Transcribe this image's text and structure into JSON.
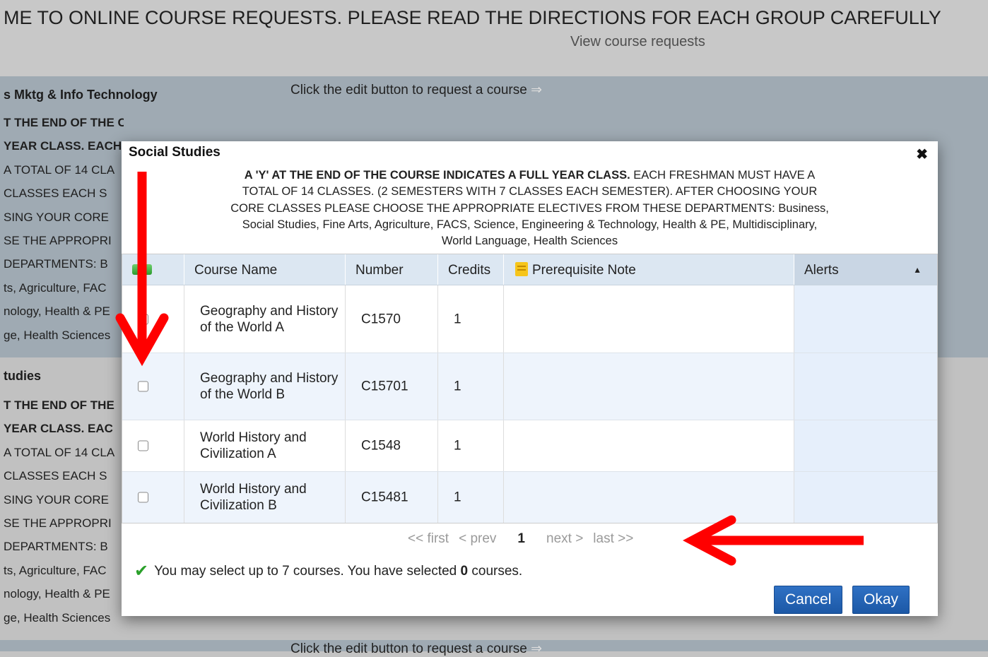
{
  "banner": {
    "title": "ME TO ONLINE COURSE REQUESTS. PLEASE READ THE DIRECTIONS FOR EACH GROUP CAREFULLY",
    "view_link": "View course requests"
  },
  "background": {
    "group1_heading": "s Mktg & Info Technology",
    "group2_heading": "tudies",
    "hint": "Click the edit button to request a course",
    "hint_bottom": "Click the edit button to request a course",
    "group1_lines": [
      "T THE END OF THE COURSE INDICATES A",
      "YEAR CLASS. EACH",
      "A TOTAL OF 14 CLA",
      "CLASSES EACH S",
      "SING YOUR CORE",
      "SE THE APPROPRI",
      "DEPARTMENTS: B",
      "ts, Agriculture, FAC",
      "nology, Health & PE",
      "ge, Health Sciences"
    ],
    "group2_lines": [
      "T THE END OF THE",
      "YEAR CLASS. EAC",
      "A TOTAL OF 14 CLA",
      "CLASSES EACH S",
      "SING YOUR CORE",
      "SE THE APPROPRI",
      "DEPARTMENTS: B",
      "ts, Agriculture, FAC",
      "nology, Health & PE",
      "ge, Health Sciences"
    ]
  },
  "modal": {
    "title": "Social Studies",
    "directions_bold": "A 'Y' AT THE END OF THE COURSE INDICATES A FULL YEAR CLASS.",
    "directions_rest": " EACH FRESHMAN MUST HAVE A TOTAL OF 14 CLASSES. (2 SEMESTERS WITH 7 CLASSES EACH SEMESTER). AFTER CHOOSING YOUR CORE CLASSES PLEASE CHOOSE THE APPROPRIATE ELECTIVES FROM THESE DEPARTMENTS: Business, Social Studies, Fine Arts, Agriculture, FACS, Science, Engineering & Technology, Health & PE, Multidisciplinary, World Language, Health Sciences",
    "columns": {
      "course_name": "Course Name",
      "number": "Number",
      "credits": "Credits",
      "prerequisite": "Prerequisite Note",
      "alerts": "Alerts"
    },
    "rows": [
      {
        "name": "Geography and History of the World A",
        "number": "C1570",
        "credits": "1"
      },
      {
        "name": "Geography and History of the World B",
        "number": "C15701",
        "credits": "1"
      },
      {
        "name": "World History and Civilization A",
        "number": "C1548",
        "credits": "1"
      },
      {
        "name": "World History and Civilization B",
        "number": "C15481",
        "credits": "1"
      }
    ],
    "pager": {
      "first": "<< first",
      "prev": "< prev",
      "current": "1",
      "next": "next >",
      "last": "last >>"
    },
    "status": {
      "pre": "You may select up to 7 courses. You have selected ",
      "count": "0",
      "post": " courses."
    },
    "cancel_label": "Cancel",
    "okay_label": "Okay"
  },
  "colors": {
    "annotation_arrow": "#ff0000",
    "button": "#1f5fae",
    "header_bg": "#dce7f2"
  }
}
